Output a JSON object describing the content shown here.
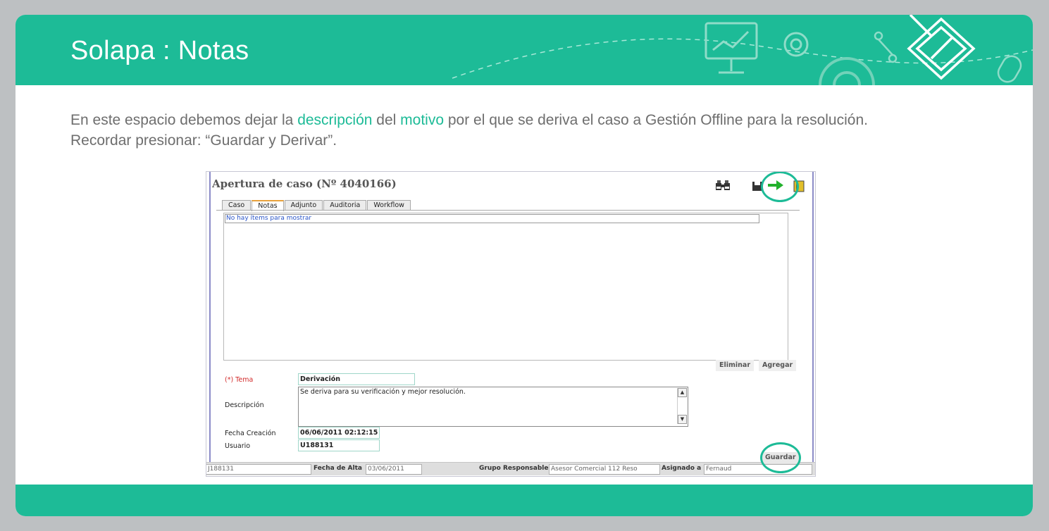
{
  "slide": {
    "title": "Solapa : Notas",
    "body_parts": [
      "En este espacio debemos dejar la ",
      "descripción",
      " del ",
      "motivo",
      " por el que se deriva el caso  a Gestión Offline para la resolución.  Recordar presionar: “Guardar y Derivar”."
    ],
    "accent_color": "#1dbb97"
  },
  "app": {
    "window_title": "Apertura de caso (Nº 4040166)",
    "toolbar_icons": [
      "binoculars-icon",
      "save-icon",
      "forward-arrow-icon",
      "notebook-icon"
    ],
    "tabs": [
      "Caso",
      "Notas",
      "Adjunto",
      "Auditoria",
      "Workflow"
    ],
    "active_tab": "Notas",
    "list_empty_text": "No hay ítems para mostrar",
    "buttons": {
      "delete": "Eliminar",
      "add": "Agregar",
      "save": "Guardar"
    },
    "form": {
      "tema_label": "(*) Tema",
      "tema_value": "Derivación",
      "descripcion_label": "Descripción",
      "descripcion_value": "Se deriva para su verificación y mejor resolución.",
      "fecha_label": "Fecha Creación",
      "fecha_value": "06/06/2011 02:12:15",
      "usuario_label": "Usuario",
      "usuario_value": "U188131"
    },
    "status_bar": {
      "user_value": "J188131",
      "fecha_alta_label": "Fecha de Alta",
      "fecha_alta_value": "03/06/2011",
      "grupo_label": "Grupo Responsable",
      "grupo_value": "Asesor Comercial 112 Reso",
      "asignado_label": "Asignado a",
      "asignado_value": "Fernaud"
    }
  }
}
